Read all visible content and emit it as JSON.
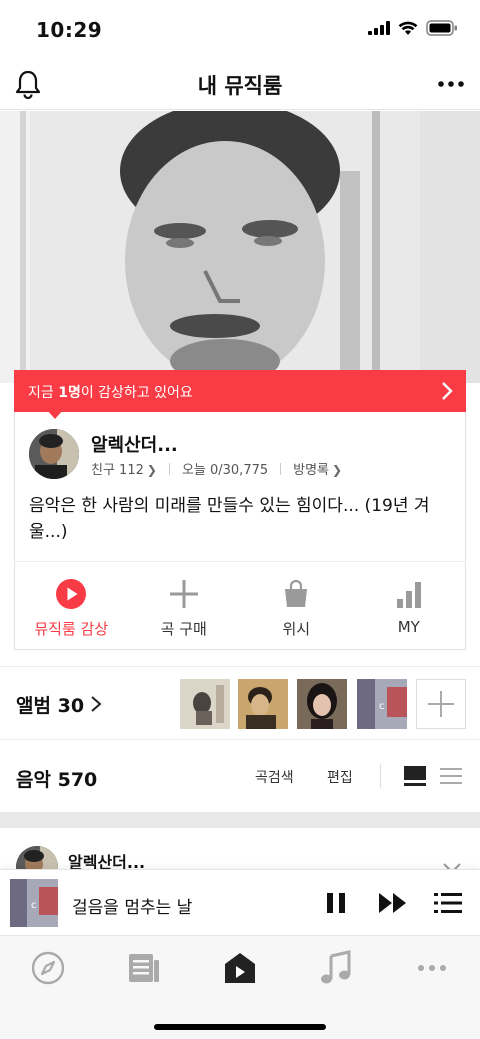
{
  "status_bar": {
    "time": "10:29"
  },
  "nav": {
    "title": "내 뮤직룸"
  },
  "banner": {
    "prefix": "지금 ",
    "count": "1명",
    "suffix": "이 감상하고 있어요"
  },
  "profile": {
    "name": "알렉산더...",
    "friends": "친구 112",
    "today": "오늘 0/30,775",
    "guestbook": "방명록",
    "bio": "음악은 한 사람의 미래를 만들수 있는 힘이다... (19년 겨울...)"
  },
  "actions": [
    {
      "label": "뮤직룸 감상",
      "icon": "play-circle-icon",
      "active": true
    },
    {
      "label": "곡 구매",
      "icon": "plus-icon",
      "active": false
    },
    {
      "label": "위시",
      "icon": "shopping-bag-icon",
      "active": false
    },
    {
      "label": "MY",
      "icon": "bar-chart-icon",
      "active": false
    }
  ],
  "albums": {
    "title": "앨범",
    "count": "30"
  },
  "music": {
    "title": "음악",
    "count": "570",
    "search": "곡검색",
    "edit": "편집"
  },
  "post": {
    "name": "알렉산더..."
  },
  "player": {
    "title": "걸음을 멈추는 날"
  },
  "tabs": [
    "compass-icon",
    "feed-icon",
    "music-room-icon",
    "music-note-icon",
    "more-icon"
  ],
  "colors": {
    "accent": "#f83b44",
    "icon_gray": "#9a9a9a",
    "dark": "#222222"
  }
}
